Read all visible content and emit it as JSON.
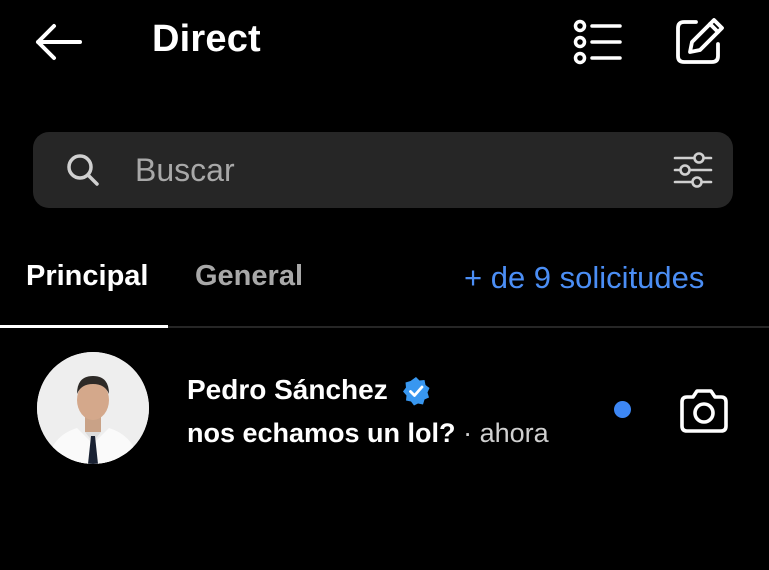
{
  "header": {
    "back_icon": "arrow-left-icon",
    "title": "Direct",
    "list_icon": "list-icon",
    "compose_icon": "compose-icon"
  },
  "search": {
    "icon": "search-icon",
    "placeholder": "Buscar",
    "filter_icon": "sliders-icon"
  },
  "tabs": {
    "items": [
      {
        "label": "Principal",
        "active": true
      },
      {
        "label": "General",
        "active": false
      }
    ],
    "requests_label": "+ de 9 solicitudes"
  },
  "threads": [
    {
      "name": "Pedro Sánchez",
      "verified": true,
      "message": "nos echamos un lol?",
      "separator": "·",
      "time": "ahora",
      "unread": true,
      "action_icon": "camera-icon"
    }
  ],
  "colors": {
    "background": "#000000",
    "search_bg": "#262626",
    "accent_blue": "#4b8ef5",
    "verified_blue": "#3897f0",
    "muted_text": "#a8a8a8"
  }
}
